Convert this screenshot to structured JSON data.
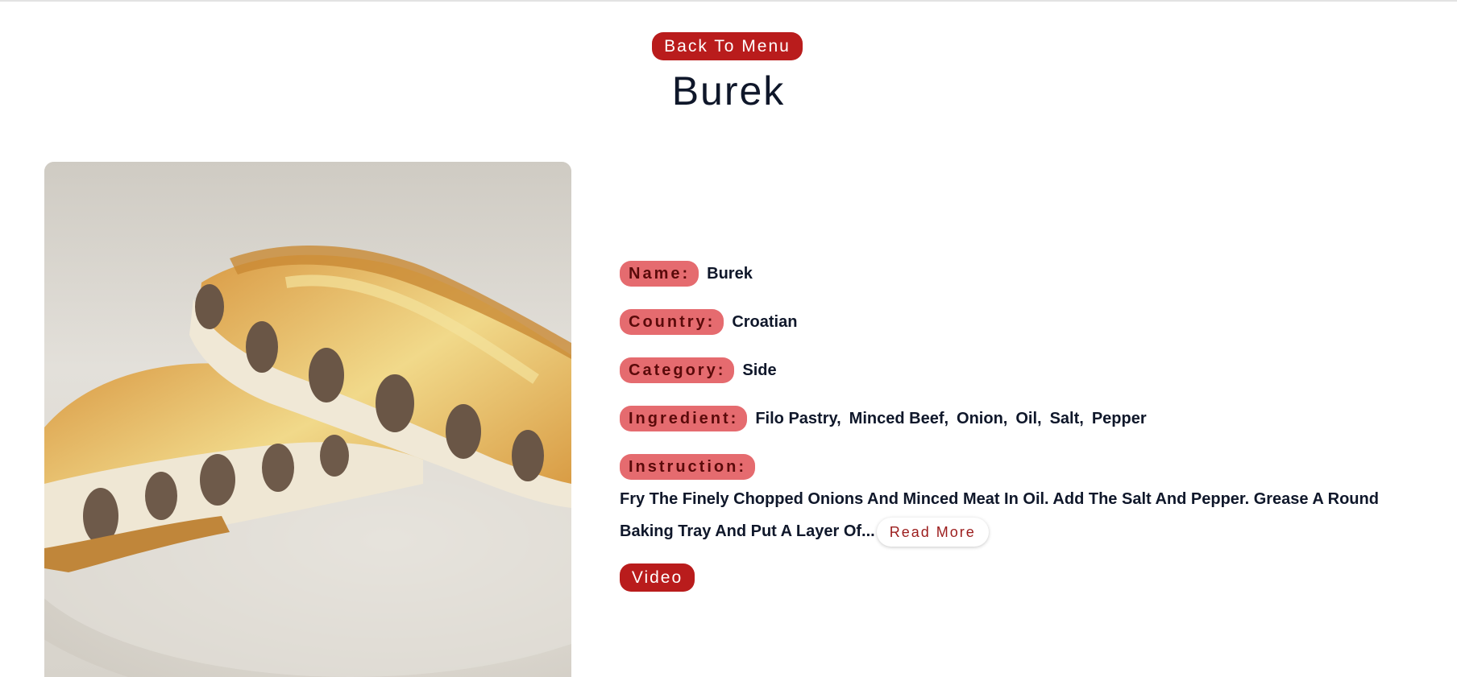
{
  "back_button_label": "Back To Menu",
  "title": "Burek",
  "image": {
    "icon": "food-photo"
  },
  "details": {
    "name_label": "Name:",
    "name_value": "Burek",
    "country_label": "Country:",
    "country_value": "Croatian",
    "category_label": "Category:",
    "category_value": "Side",
    "ingredient_label": "Ingredient:",
    "ingredients": [
      "Filo Pastry,",
      "Minced Beef,",
      "Onion,",
      "Oil,",
      "Salt,",
      "Pepper"
    ],
    "instruction_label": "Instruction:",
    "instruction_text": "Fry The Finely Chopped Onions And Minced Meat In Oil. Add The Salt And Pepper. Grease A Round Baking Tray And Put A Layer Of...",
    "read_more_label": "Read More"
  },
  "video_button_label": "Video",
  "colors": {
    "accent": "#b91c1c",
    "tag_bg": "#e56b6f",
    "text": "#0f172a"
  }
}
